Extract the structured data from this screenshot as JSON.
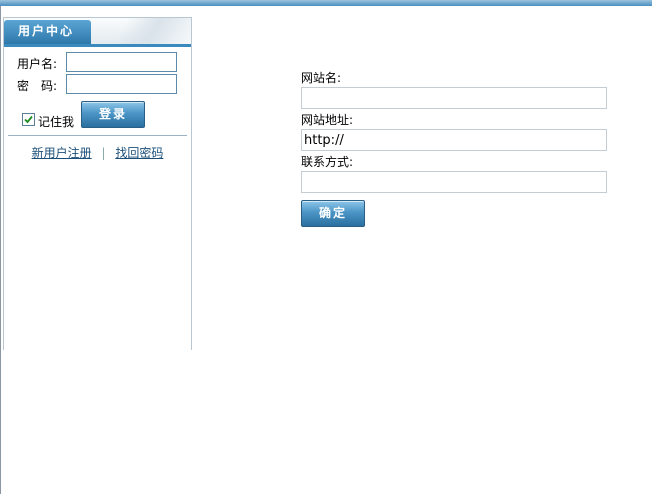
{
  "user_center": {
    "title": "用户中心",
    "username_label": "用户名:",
    "password_label": "密　码:",
    "username_value": "",
    "password_value": "",
    "remember_label": "记住我",
    "remember_checked": true,
    "login_button": "登录",
    "register_link": "新用户注册",
    "link_divider": "|",
    "forgot_link": "找回密码"
  },
  "site_form": {
    "site_name_label": "网站名:",
    "site_name_value": "",
    "site_url_label": "网站地址:",
    "site_url_value": "http://",
    "contact_label": "联系方式:",
    "contact_value": "",
    "submit_button": "确定"
  },
  "colors": {
    "accent": "#3b8abd",
    "link": "#1b4f7a"
  }
}
